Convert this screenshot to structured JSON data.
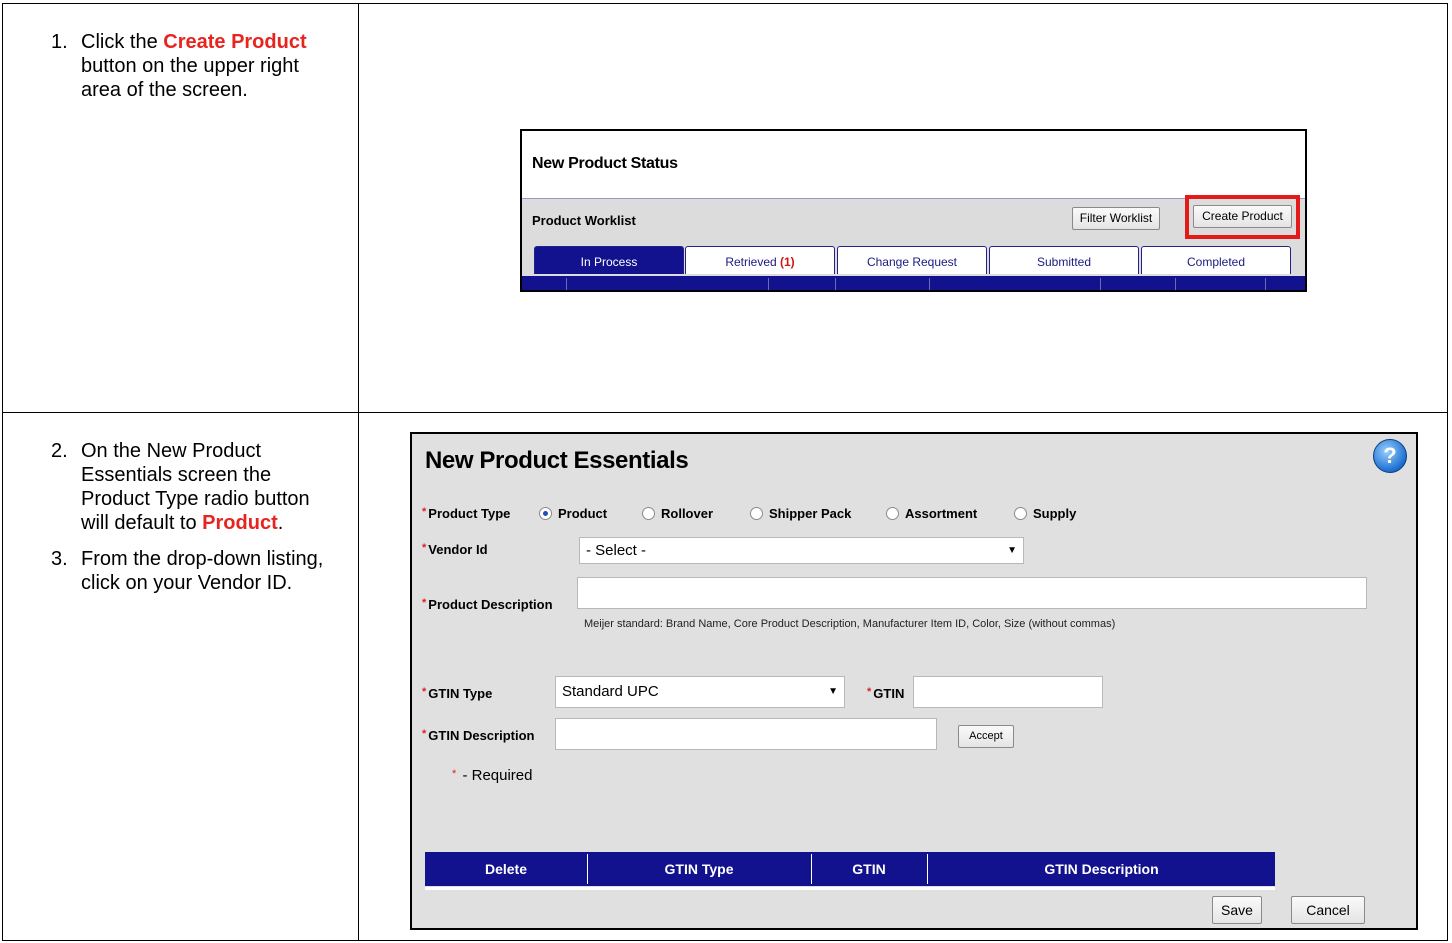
{
  "steps_top": [
    {
      "num": "1.",
      "pre": "Click the ",
      "highlight": "Create Product",
      "post": " button on the upper right area of the screen."
    }
  ],
  "steps_bottom": [
    {
      "num": "2.",
      "pre": "On the New Product Essentials screen the Product Type radio button will default to ",
      "highlight": "Product",
      "post": "."
    },
    {
      "num": "3.",
      "pre": "From the drop-down listing, click on your Vendor ID.",
      "highlight": "",
      "post": ""
    }
  ],
  "status_screen": {
    "title": "New Product Status",
    "worklist_label": "Product Worklist",
    "filter_button": "Filter Worklist",
    "create_button": "Create Product",
    "tabs": [
      {
        "label": "In Process",
        "count": ""
      },
      {
        "label": "Retrieved",
        "count": "(1)"
      },
      {
        "label": "Change Request",
        "count": ""
      },
      {
        "label": "Submitted",
        "count": ""
      },
      {
        "label": "Completed",
        "count": ""
      }
    ],
    "colors": {
      "highlight_box": "#e21a1a",
      "tab_active": "#12128f"
    }
  },
  "essentials_screen": {
    "title": "New Product Essentials",
    "help_icon": "?",
    "required_marker": "*",
    "product_type_label": "Product Type",
    "product_type_options": [
      "Product",
      "Rollover",
      "Shipper Pack",
      "Assortment",
      "Supply"
    ],
    "product_type_selected": "Product",
    "vendor_label": "Vendor Id",
    "vendor_value": "- Select -",
    "description_label": "Product Description",
    "description_value": "",
    "description_hint": "Meijer standard: Brand Name, Core Product Description, Manufacturer Item ID, Color, Size (without commas)",
    "gtin_type_label": "GTIN Type",
    "gtin_type_value": "Standard UPC",
    "gtin_label": "GTIN",
    "gtin_value": "",
    "gtin_desc_label": "GTIN Description",
    "gtin_desc_value": "",
    "accept_button": "Accept",
    "required_note": "- Required",
    "grid_columns": [
      "Delete",
      "GTIN Type",
      "GTIN",
      "GTIN Description"
    ],
    "save_button": "Save",
    "cancel_button": "Cancel"
  }
}
